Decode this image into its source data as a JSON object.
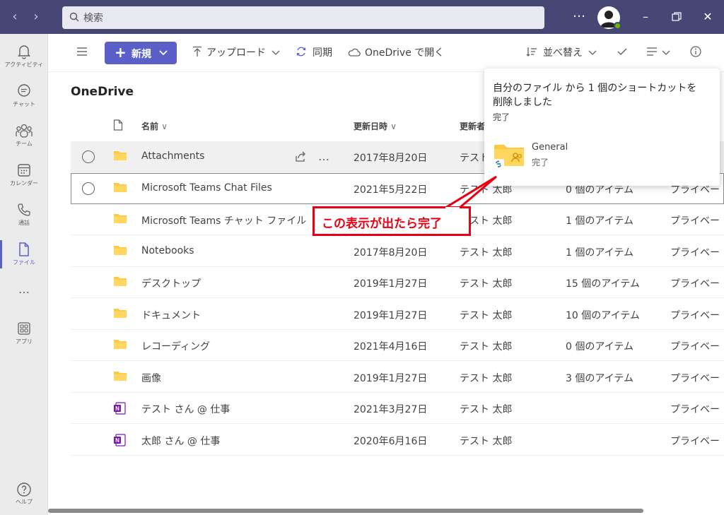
{
  "titlebar": {
    "search_placeholder": "検索",
    "more": "…"
  },
  "rail": {
    "items": [
      {
        "label": "アクティビティ",
        "icon": "bell-icon"
      },
      {
        "label": "チャット",
        "icon": "chat-icon"
      },
      {
        "label": "チーム",
        "icon": "teams-icon"
      },
      {
        "label": "カレンダー",
        "icon": "calendar-icon"
      },
      {
        "label": "通話",
        "icon": "phone-icon"
      },
      {
        "label": "ファイル",
        "icon": "file-icon"
      }
    ],
    "more": "…",
    "apps": "アプリ",
    "help": "ヘルプ"
  },
  "toolbar": {
    "new_label": "新規",
    "upload_label": "アップロード",
    "sync_label": "同期",
    "open_label": "OneDrive で開く",
    "sort_label": "並べ替え"
  },
  "page": {
    "title": "OneDrive"
  },
  "table": {
    "headers": {
      "name": "名前",
      "modified": "更新日時",
      "modified_by": "更新者"
    },
    "rows": [
      {
        "name": "Attachments",
        "date": "2017年8月20日",
        "by": "テスト 太郎",
        "items": "",
        "sharing": "",
        "type": "folder"
      },
      {
        "name": "Microsoft Teams Chat Files",
        "date": "2021年5月22日",
        "by": "テスト 太郎",
        "items": "0 個のアイテム",
        "sharing": "プライベー",
        "type": "folder"
      },
      {
        "name": "Microsoft Teams チャット ファイル",
        "date": "2019年1月27日",
        "by": "テスト 太郎",
        "items": "1 個のアイテム",
        "sharing": "プライベー",
        "type": "folder"
      },
      {
        "name": "Notebooks",
        "date": "2017年8月20日",
        "by": "テスト 太郎",
        "items": "1 個のアイテム",
        "sharing": "プライベー",
        "type": "folder"
      },
      {
        "name": "デスクトップ",
        "date": "2019年1月27日",
        "by": "テスト 太郎",
        "items": "15 個のアイテム",
        "sharing": "プライベー",
        "type": "folder"
      },
      {
        "name": "ドキュメント",
        "date": "2019年1月27日",
        "by": "テスト 太郎",
        "items": "10 個のアイテム",
        "sharing": "プライベー",
        "type": "folder"
      },
      {
        "name": "レコーディング",
        "date": "2021年4月16日",
        "by": "テスト 太郎",
        "items": "0 個のアイテム",
        "sharing": "プライベー",
        "type": "folder"
      },
      {
        "name": "画像",
        "date": "2019年1月27日",
        "by": "テスト 太郎",
        "items": "3 個のアイテム",
        "sharing": "プライベー",
        "type": "folder"
      },
      {
        "name": "テスト さん @ 仕事",
        "date": "2021年3月27日",
        "by": "テスト 太郎",
        "items": "",
        "sharing": "プライベー",
        "type": "onenote"
      },
      {
        "name": "太郎 さん @ 仕事",
        "date": "2020年6月16日",
        "by": "テスト 太郎",
        "items": "",
        "sharing": "プライベー",
        "type": "onenote"
      }
    ]
  },
  "flyout": {
    "message": "自分のファイル から 1 個のショートカットを削除しました",
    "status": "完了",
    "item_name": "General",
    "item_status": "完了"
  },
  "callout": {
    "text": "この表示が出たら完了"
  },
  "colors": {
    "titlebar": "#464775",
    "accent": "#5b5fc7",
    "callout": "#e60012",
    "folder": "#ffc83d"
  }
}
